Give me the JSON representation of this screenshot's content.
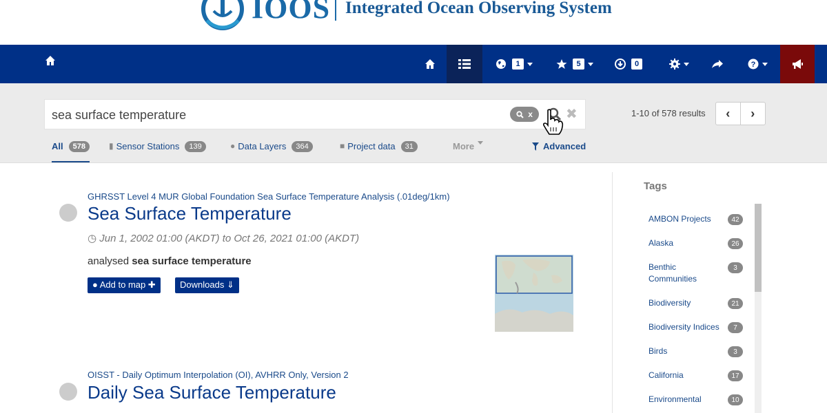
{
  "header": {
    "logo_word": "IOOS",
    "logo_full": "Integrated Ocean Observing System"
  },
  "navbar": {
    "globe_badge": "1",
    "star_badge": "5",
    "download_badge": "0",
    "colors": {
      "bar": "#003087",
      "active": "#0b2359",
      "alert": "#7a0a0a"
    }
  },
  "search": {
    "query": "sea surface temperature",
    "chip_label": "x",
    "clear_label": "✖",
    "result_count": "1-10 of 578 results",
    "prev_label": "‹",
    "next_label": "›"
  },
  "tabs": [
    {
      "label": "All",
      "count": "578"
    },
    {
      "label": "Sensor Stations",
      "count": "139"
    },
    {
      "label": "Data Layers",
      "count": "364"
    },
    {
      "label": "Project data",
      "count": "31"
    },
    {
      "label": "More"
    },
    {
      "label": "Advanced"
    }
  ],
  "results": [
    {
      "subtitle": "GHRSST Level 4 MUR Global Foundation Sea Surface Temperature Analysis (.01deg/1km)",
      "title": "Sea Surface Temperature",
      "date": "Jun 1, 2002 01:00 (AKDT) to Oct 26, 2021 01:00 (AKDT)",
      "desc_prefix": "analysed ",
      "desc_bold": "sea surface temperature",
      "add_to_map": "Add to map",
      "downloads": "Downloads"
    },
    {
      "subtitle": "OISST - Daily Optimum Interpolation (OI), AVHRR Only, Version 2",
      "title": "Daily Sea Surface Temperature"
    }
  ],
  "sidebar": {
    "title": "Tags",
    "tags": [
      {
        "label": "AMBON Projects",
        "count": "42"
      },
      {
        "label": "Alaska",
        "count": "26"
      },
      {
        "label": "Benthic Communities",
        "count": "3"
      },
      {
        "label": "Biodiversity",
        "count": "21"
      },
      {
        "label": "Biodiversity Indices",
        "count": "7"
      },
      {
        "label": "Birds",
        "count": "3"
      },
      {
        "label": "California",
        "count": "17"
      },
      {
        "label": "Environmental",
        "count": "10"
      }
    ]
  }
}
